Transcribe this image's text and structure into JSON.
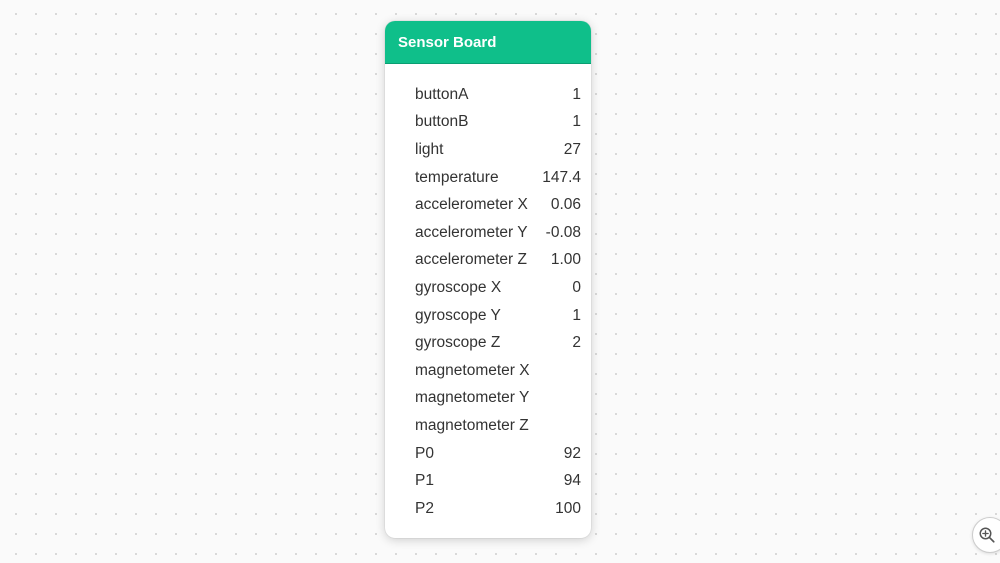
{
  "board": {
    "title": "Sensor Board",
    "header_color": "#0fbf8a",
    "rows": [
      {
        "label": "buttonA",
        "value": "1"
      },
      {
        "label": "buttonB",
        "value": "1"
      },
      {
        "label": "light",
        "value": "27"
      },
      {
        "label": "temperature",
        "value": "147.4"
      },
      {
        "label": "accelerometer X",
        "value": "0.06"
      },
      {
        "label": "accelerometer Y",
        "value": "-0.08"
      },
      {
        "label": "accelerometer Z",
        "value": "1.00"
      },
      {
        "label": "gyroscope X",
        "value": "0"
      },
      {
        "label": "gyroscope Y",
        "value": "1"
      },
      {
        "label": "gyroscope Z",
        "value": "2"
      },
      {
        "label": "magnetometer X",
        "value": ""
      },
      {
        "label": "magnetometer Y",
        "value": ""
      },
      {
        "label": "magnetometer Z",
        "value": ""
      },
      {
        "label": "P0",
        "value": "92"
      },
      {
        "label": "P1",
        "value": "94"
      },
      {
        "label": "P2",
        "value": "100"
      }
    ]
  },
  "controls": {
    "zoom_icon": "zoom-in-icon"
  }
}
